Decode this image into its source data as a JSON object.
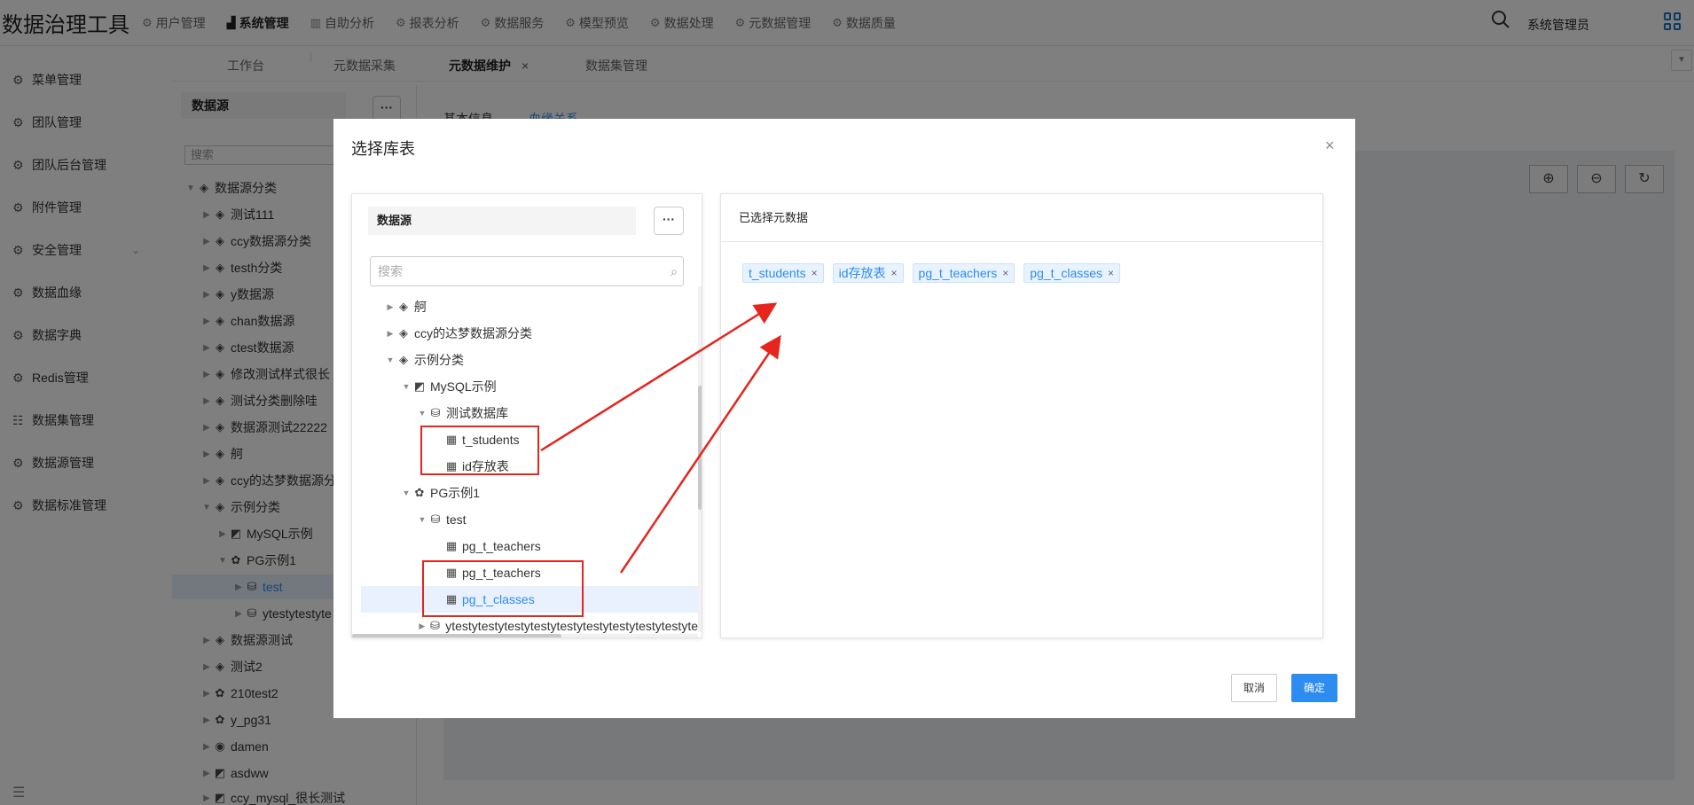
{
  "app": {
    "title": "数据治理工具",
    "user": "系统管理员"
  },
  "topnav": [
    {
      "label": "用户管理",
      "icon": "gear-icon",
      "active": false
    },
    {
      "label": "系统管理",
      "icon": "bar-chart-icon",
      "active": true
    },
    {
      "label": "自助分析",
      "icon": "bar-chart-icon",
      "active": false
    },
    {
      "label": "报表分析",
      "icon": "gear-icon",
      "active": false
    },
    {
      "label": "数据服务",
      "icon": "gear-icon",
      "active": false
    },
    {
      "label": "模型预览",
      "icon": "gear-icon",
      "active": false
    },
    {
      "label": "数据处理",
      "icon": "gear-icon",
      "active": false
    },
    {
      "label": "元数据管理",
      "icon": "gear-icon",
      "active": false
    },
    {
      "label": "数据质量",
      "icon": "gear-icon",
      "active": false
    }
  ],
  "tabs": [
    {
      "label": "工作台"
    },
    {
      "label": "元数据采集"
    },
    {
      "label": "元数据维护",
      "close": "×"
    },
    {
      "label": "数据集管理"
    }
  ],
  "sidebar": [
    {
      "label": "菜单管理"
    },
    {
      "label": "团队管理"
    },
    {
      "label": "团队后台管理"
    },
    {
      "label": "附件管理"
    },
    {
      "label": "安全管理"
    },
    {
      "label": "数据血缘"
    },
    {
      "label": "数据字典"
    },
    {
      "label": "Redis管理"
    },
    {
      "label": "数据集管理"
    },
    {
      "label": "数据源管理"
    },
    {
      "label": "数据标准管理"
    }
  ],
  "leftpanel": {
    "title": "数据源",
    "more": "···",
    "search_placeholder": "搜索",
    "tree": [
      {
        "label": "数据源分类"
      },
      {
        "label": "测试111"
      },
      {
        "label": "ccy数据源分类"
      },
      {
        "label": "testh分类"
      },
      {
        "label": "y数据源"
      },
      {
        "label": "chan数据源"
      },
      {
        "label": "ctest数据源"
      },
      {
        "label": "修改测试样式很长"
      },
      {
        "label": "测试分类删除哇"
      },
      {
        "label": "数据源测试22222"
      },
      {
        "label": "舸"
      },
      {
        "label": "ccy的达梦数据源分"
      },
      {
        "label": "示例分类"
      },
      {
        "label": "MySQL示例"
      },
      {
        "label": "PG示例1"
      },
      {
        "label": "test"
      },
      {
        "label": "ytestytestyte"
      },
      {
        "label": "数据源测试"
      },
      {
        "label": "测试2"
      },
      {
        "label": "210test2"
      },
      {
        "label": "y_pg31"
      },
      {
        "label": "damen"
      },
      {
        "label": "asdww"
      },
      {
        "label": "ccy_mysql_很长测试"
      }
    ]
  },
  "main": {
    "tab_basic": "基本信息",
    "tab_lineage": "血缘关系"
  },
  "dialog": {
    "title": "选择库表",
    "close": "×",
    "left": {
      "title": "数据源",
      "more": "···",
      "search_placeholder": "搜索",
      "tree": [
        {
          "label": "舸"
        },
        {
          "label": "ccy的达梦数据源分类"
        },
        {
          "label": "示例分类"
        },
        {
          "label": "MySQL示例"
        },
        {
          "label": "测试数据库"
        },
        {
          "label": "t_students"
        },
        {
          "label": "id存放表"
        },
        {
          "label": "PG示例1"
        },
        {
          "label": "test"
        },
        {
          "label": "pg_t_teachers"
        },
        {
          "label": "pg_t_teachers"
        },
        {
          "label": "pg_t_classes"
        },
        {
          "label": "ytestytestytestytestytestytestytestytestytestyte"
        }
      ]
    },
    "right": {
      "title": "已选择元数据",
      "tags": [
        {
          "label": "t_students"
        },
        {
          "label": "id存放表"
        },
        {
          "label": "pg_t_teachers"
        },
        {
          "label": "pg_t_classes"
        }
      ]
    },
    "cancel": "取消",
    "ok": "确定"
  },
  "colors": {
    "accent": "#2d8cf0",
    "annotation": "#e5251e",
    "mask": "rgba(0,0,0,0.5)"
  }
}
